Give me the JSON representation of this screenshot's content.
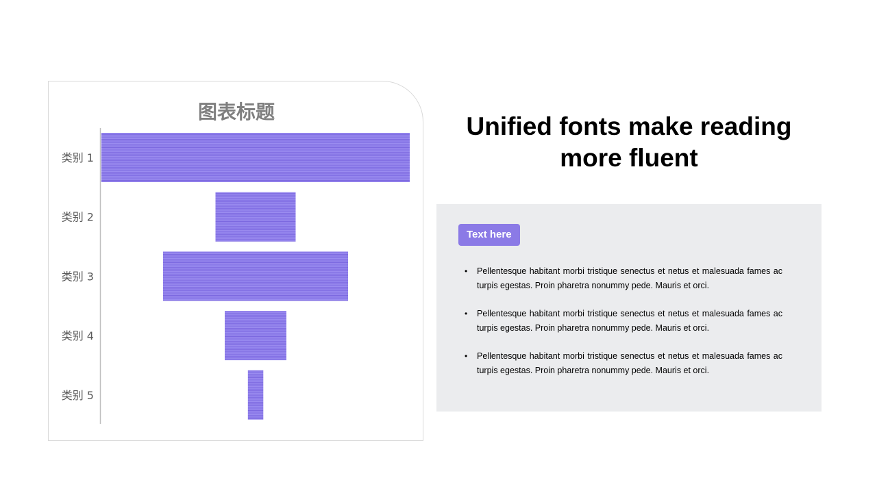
{
  "slide": {
    "headline_line1": "Unified fonts make reading",
    "headline_line2": "more fluent",
    "tag_label": "Text here",
    "bullets": [
      "Pellentesque habitant morbi tristique senectus et netus et malesuada fames ac turpis egestas. Proin pharetra nonummy  pede. Mauris et orci.",
      "Pellentesque habitant morbi tristique senectus et netus et malesuada fames ac turpis egestas. Proin pharetra nonummy  pede. Mauris et orci.",
      "Pellentesque habitant morbi tristique senectus et netus et malesuada fames ac turpis egestas. Proin pharetra nonummy  pede. Mauris et orci."
    ]
  },
  "colors": {
    "bar_fill": "#9b8cf0",
    "bar_stripe": "#7b68e0",
    "tag_bg": "#8b7ae6",
    "panel_bg": "#ebecee"
  },
  "chart_data": {
    "type": "bar",
    "subtype": "funnel",
    "orientation": "horizontal",
    "title": "图表标题",
    "categories": [
      "类别 1",
      "类别 2",
      "类别 3",
      "类别 4",
      "类别 5"
    ],
    "values": [
      100,
      26,
      60,
      20,
      5
    ],
    "bar_pattern": "horizontal-stripes",
    "grid": false,
    "legend": "none"
  }
}
